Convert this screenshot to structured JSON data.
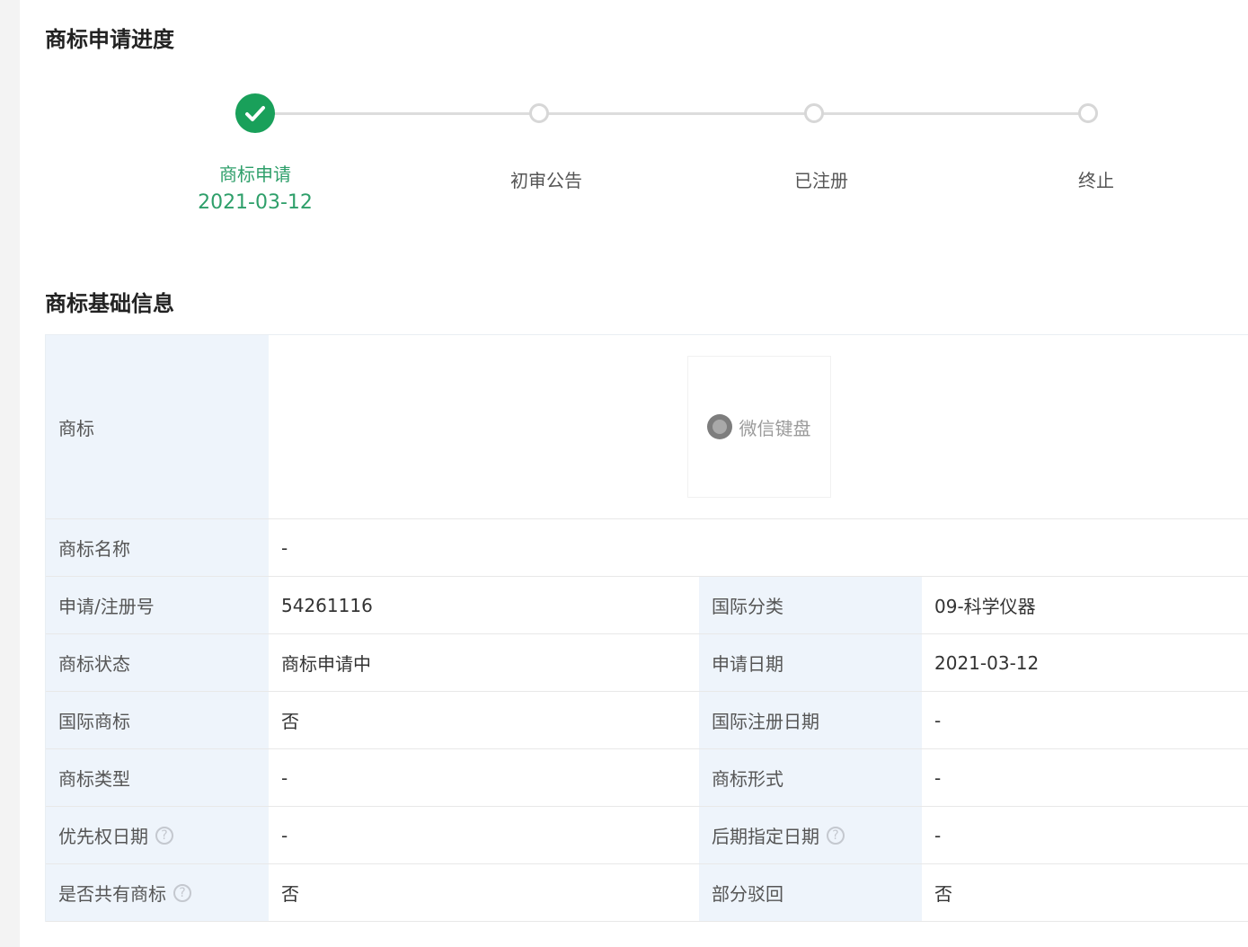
{
  "sections": {
    "progress_title": "商标申请进度",
    "basic_title": "商标基础信息"
  },
  "steps": [
    {
      "label": "商标申请",
      "date": "2021-03-12",
      "state": "done"
    },
    {
      "label": "初审公告",
      "date": "",
      "state": "pending"
    },
    {
      "label": "已注册",
      "date": "",
      "state": "pending"
    },
    {
      "label": "终止",
      "date": "",
      "state": "pending"
    }
  ],
  "colors": {
    "accent_green": "#19a05a",
    "label_green": "#2e9f6a",
    "table_key_bg": "#eef4fb"
  },
  "table": {
    "trademark_label": "商标",
    "trademark_logo_text": "微信键盘",
    "trademark_name_label": "商标名称",
    "trademark_name_value": "-",
    "rows": [
      {
        "k1": "申请/注册号",
        "v1": "54261116",
        "k2": "国际分类",
        "v2": "09-科学仪器"
      },
      {
        "k1": "商标状态",
        "v1": "商标申请中",
        "k2": "申请日期",
        "v2": "2021-03-12"
      },
      {
        "k1": "国际商标",
        "v1": "否",
        "k2": "国际注册日期",
        "v2": "-"
      },
      {
        "k1": "商标类型",
        "v1": "-",
        "k2": "商标形式",
        "v2": "-"
      },
      {
        "k1": "优先权日期",
        "v1": "-",
        "k2": "后期指定日期",
        "v2": "-"
      },
      {
        "k1": "是否共有商标",
        "v1": "否",
        "k2": "部分驳回",
        "v2": "否"
      }
    ],
    "help_icon": "?"
  }
}
